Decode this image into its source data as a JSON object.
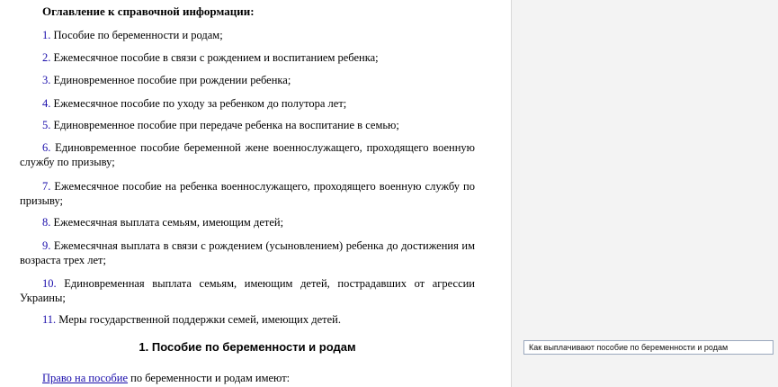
{
  "toc": {
    "title": "Оглавление к справочной информации:",
    "items": [
      {
        "num": "1.",
        "text": " Пособие по беременности и родам;"
      },
      {
        "num": "2.",
        "text": " Ежемесячное пособие в связи с рождением и воспитанием ребенка;"
      },
      {
        "num": "3.",
        "text": " Единовременное пособие при рождении ребенка;"
      },
      {
        "num": "4.",
        "text": " Ежемесячное пособие по уходу за ребенком до полутора лет;"
      },
      {
        "num": "5.",
        "text": " Единовременное пособие при передаче ребенка на воспитание в семью;"
      },
      {
        "num": "6.",
        "text": " Единовременное пособие беременной жене военнослужащего, проходящего военную службу по призыву;"
      },
      {
        "num": "7.",
        "text": " Ежемесячное пособие на ребенка военнослужащего, проходящего военную службу по призыву;"
      },
      {
        "num": "8.",
        "text": " Ежемесячная выплата семьям, имеющим детей;"
      },
      {
        "num": "9.",
        "text": " Ежемесячная выплата в связи с рождением (усыновлением) ребенка до достижения им возраста трех лет;"
      },
      {
        "num": "10.",
        "text": " Единовременная выплата семьям, имеющим детей, пострадавших от агрессии Украины;"
      },
      {
        "num": "11.",
        "text": " Меры государственной поддержки семей, имеющих детей."
      }
    ]
  },
  "section": {
    "title": "1. Пособие по беременности и родам",
    "link_text": "Право на пособие",
    "rest_text": " по беременности и родам имеют:"
  },
  "margin_note": {
    "text": "Как выплачивают пособие по беременности и родам"
  }
}
